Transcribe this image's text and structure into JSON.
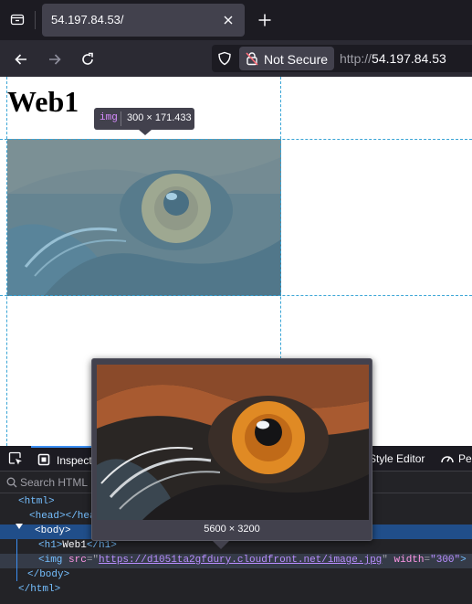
{
  "tab": {
    "title": "54.197.84.53/"
  },
  "urlbar": {
    "security_label": "Not Secure",
    "url_protocol": "http://",
    "url_host": "54.197.84.53"
  },
  "page": {
    "heading": "Web1",
    "image_tooltip": {
      "tag": "img",
      "dimensions": "300 × 171.433"
    }
  },
  "devtools": {
    "tabs": {
      "inspector": "Inspector",
      "style_editor": "Style Editor",
      "performance": "Performance"
    },
    "search_placeholder": "Search HTML",
    "markup": {
      "html_open": "<html>",
      "head": "<head></head>",
      "body_open": "<body>",
      "h1_open": "<h1>",
      "h1_text": "Web1",
      "h1_close": "</h1>",
      "img_open": "<img ",
      "img_src_attr": "src",
      "img_src_value": "https://d1051ta2gfdury.cloudfront.net/image.jpg",
      "img_width_attr": "width",
      "img_width_value": "\"300\"",
      "img_close": ">",
      "body_close": "</body>",
      "html_close": "</html>"
    },
    "preview": {
      "dimensions": "5600 × 3200"
    }
  },
  "colors": {
    "chrome_dark": "#1c1b22",
    "toolbar": "#2b2a33",
    "tab_active": "#42414d",
    "guide": "#3aa5d6",
    "selected_row": "#204e8a"
  }
}
